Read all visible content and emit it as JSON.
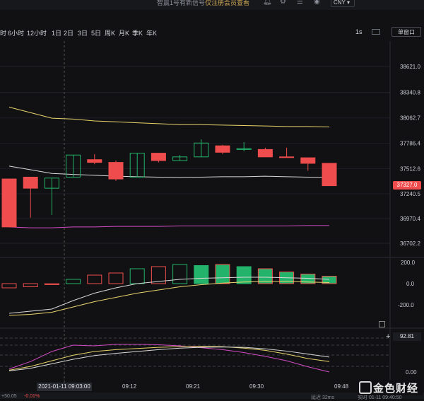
{
  "topbar": {
    "signal_text": "智赢1号有新信号",
    "signal_link": "仅注册会员查看",
    "currency": "CNY"
  },
  "toolbar": {
    "timeframes": [
      "时",
      "6小时",
      "12小时",
      "1日",
      "2日",
      "3日",
      "5日",
      "周K",
      "月K",
      "季K",
      "年K"
    ],
    "refresh": "1s",
    "single_window": "单窗口"
  },
  "price_axis": [
    "38621.0",
    "38340.8",
    "38062.7",
    "37786.4",
    "37512.6",
    "37240.5",
    "36970.4",
    "36702.2"
  ],
  "current_price": "37327.0",
  "volume_axis": [
    "200.0",
    "0.0",
    "-200.0"
  ],
  "indicator_axis": [
    "92.81",
    "0.00"
  ],
  "time_axis": [
    "09:12",
    "09:21",
    "09:30",
    "09:48"
  ],
  "cursor_time": "2021-01-11 09:03:00",
  "bottom_status": [
    "+50.05",
    "-0.01%",
    "延迟 32ms",
    "实时 01-11 09:40:50"
  ],
  "logo_text": "金色财经",
  "colors": {
    "up": "#ef4d4d",
    "down": "#23b36a",
    "ma_yellow": "#e8d36a",
    "ma_white": "#d9d9d9",
    "ma_pink": "#d24bc4"
  },
  "chart_data": {
    "type": "candlestick",
    "candles": [
      {
        "o": 37400,
        "c": 36880,
        "h": 37400,
        "l": 36880
      },
      {
        "o": 37420,
        "c": 37300,
        "h": 37420,
        "l": 36980
      },
      {
        "o": 37300,
        "c": 37410,
        "h": 37410,
        "l": 37010
      },
      {
        "o": 37420,
        "c": 37660,
        "h": 37660,
        "l": 37420
      },
      {
        "o": 37610,
        "c": 37580,
        "h": 37670,
        "l": 37560
      },
      {
        "o": 37580,
        "c": 37400,
        "h": 37600,
        "l": 37380
      },
      {
        "o": 37420,
        "c": 37680,
        "h": 37680,
        "l": 37420
      },
      {
        "o": 37680,
        "c": 37600,
        "h": 37680,
        "l": 37580
      },
      {
        "o": 37600,
        "c": 37640,
        "h": 37660,
        "l": 37600
      },
      {
        "o": 37640,
        "c": 37790,
        "h": 37830,
        "l": 37640
      },
      {
        "o": 37760,
        "c": 37690,
        "h": 37770,
        "l": 37670
      },
      {
        "o": 37720,
        "c": 37730,
        "h": 37800,
        "l": 37700
      },
      {
        "o": 37720,
        "c": 37640,
        "h": 37740,
        "l": 37640
      },
      {
        "o": 37640,
        "c": 37635,
        "h": 37740,
        "l": 37635
      },
      {
        "o": 37630,
        "c": 37570,
        "h": 37630,
        "l": 37490
      },
      {
        "o": 37570,
        "c": 37327,
        "h": 37570,
        "l": 37327
      }
    ],
    "ma_upper": [
      38180,
      38120,
      38060,
      38050,
      38030,
      38020,
      38010,
      38000,
      37990,
      37990,
      37985,
      37980,
      37975,
      37970,
      37970,
      37965
    ],
    "ma_middle": [
      37540,
      37500,
      37460,
      37450,
      37440,
      37430,
      37425,
      37420,
      37418,
      37420,
      37425,
      37425,
      37430,
      37425,
      37420,
      37420
    ],
    "ma_lower": [
      36880,
      36870,
      36870,
      36880,
      36880,
      36885,
      36885,
      36885,
      36890,
      36890,
      36890,
      36890,
      36890,
      36890,
      36895,
      36895
    ],
    "volume": [
      -40,
      -30,
      -10,
      40,
      80,
      100,
      140,
      160,
      180,
      170,
      180,
      160,
      140,
      110,
      90,
      70
    ],
    "vol_ma1": [
      -280,
      -260,
      -240,
      -160,
      -90,
      -40,
      0,
      20,
      40,
      50,
      55,
      60,
      60,
      55,
      50,
      40
    ],
    "vol_ma2": [
      -300,
      -290,
      -270,
      -220,
      -170,
      -130,
      -90,
      -60,
      -30,
      -10,
      5,
      15,
      20,
      20,
      15,
      10
    ],
    "ind_k": [
      8,
      28,
      55,
      72,
      70,
      74,
      74,
      73,
      70,
      65,
      60,
      52,
      42,
      30,
      14,
      0
    ],
    "ind_d": [
      5,
      15,
      30,
      45,
      55,
      60,
      63,
      66,
      68,
      69,
      68,
      64,
      58,
      48,
      36,
      28
    ],
    "ind_j": [
      3,
      10,
      22,
      34,
      44,
      50,
      55,
      60,
      64,
      66,
      67,
      66,
      62,
      56,
      48,
      40
    ]
  }
}
